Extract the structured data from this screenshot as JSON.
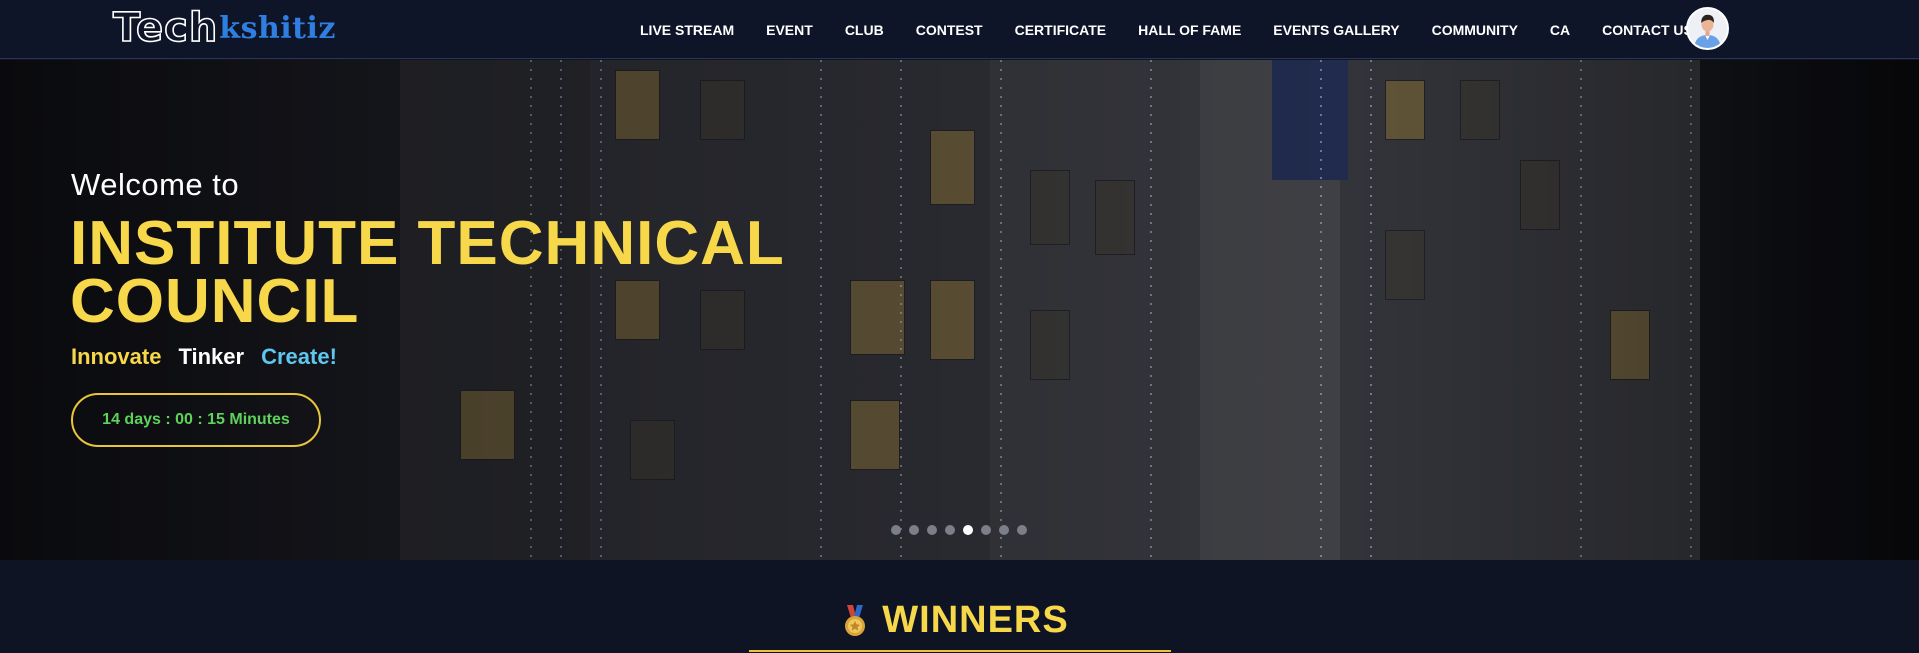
{
  "brand": {
    "logo_part1": "Tech",
    "logo_part2": "kshitiz"
  },
  "nav": {
    "items": [
      {
        "label": "LIVE STREAM"
      },
      {
        "label": "EVENT"
      },
      {
        "label": "CLUB"
      },
      {
        "label": "CONTEST"
      },
      {
        "label": "CERTIFICATE"
      },
      {
        "label": "HALL OF FAME"
      },
      {
        "label": "EVENTS GALLERY"
      },
      {
        "label": "COMMUNITY"
      },
      {
        "label": "CA"
      },
      {
        "label": "CONTACT US"
      }
    ],
    "avatar_icon": "user-avatar-icon"
  },
  "hero": {
    "welcome": "Welcome to",
    "title": "INSTITUTE TECHNICAL COUNCIL",
    "taglines": [
      {
        "text": "Innovate",
        "color": "#f6d84a"
      },
      {
        "text": "Tinker",
        "color": "#ffffff"
      },
      {
        "text": "Create!",
        "color": "#5ec6f0"
      }
    ],
    "countdown": "14 days : 00 : 15 Minutes",
    "slides": {
      "count": 8,
      "active_index": 4
    }
  },
  "winners": {
    "heading": "WINNERS",
    "icon": "medal-icon"
  },
  "colors": {
    "accent": "#f6d84a",
    "nav_bg": "#0f1528",
    "countdown_text": "#5ed25a",
    "logo_blue": "#2f7fe0"
  }
}
